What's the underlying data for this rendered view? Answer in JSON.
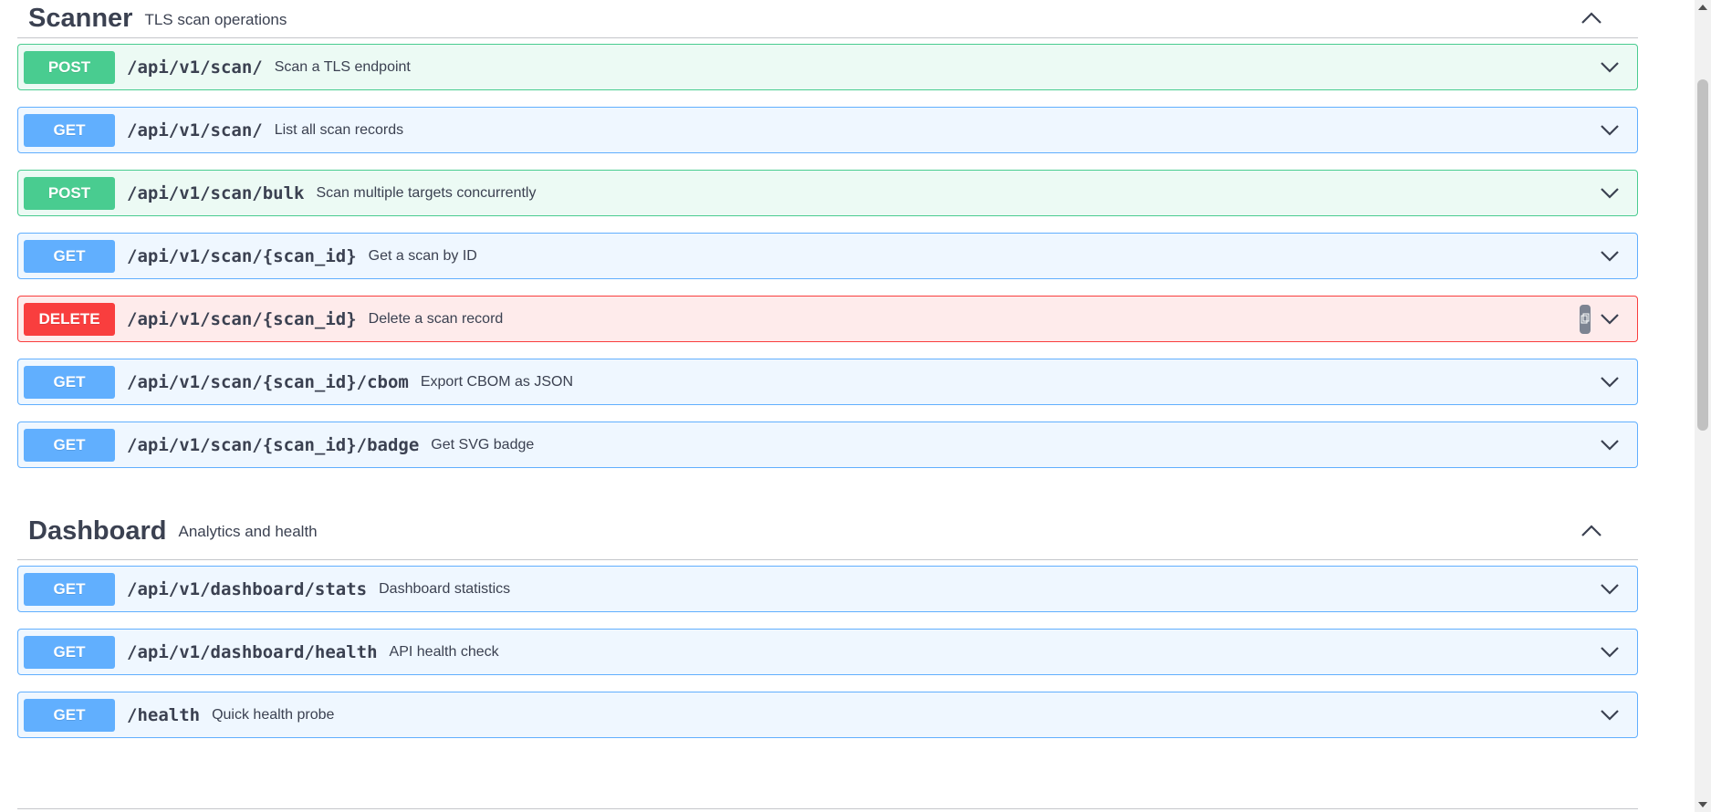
{
  "sections": [
    {
      "name": "Scanner",
      "description": "TLS scan operations",
      "operations": [
        {
          "method": "POST",
          "path": "/api/v1/scan/",
          "summary": "Scan a TLS endpoint"
        },
        {
          "method": "GET",
          "path": "/api/v1/scan/",
          "summary": "List all scan records"
        },
        {
          "method": "POST",
          "path": "/api/v1/scan/bulk",
          "summary": "Scan multiple targets concurrently"
        },
        {
          "method": "GET",
          "path": "/api/v1/scan/{scan_id}",
          "summary": "Get a scan by ID"
        },
        {
          "method": "DELETE",
          "path": "/api/v1/scan/{scan_id}",
          "summary": "Delete a scan record"
        },
        {
          "method": "GET",
          "path": "/api/v1/scan/{scan_id}/cbom",
          "summary": "Export CBOM as JSON"
        },
        {
          "method": "GET",
          "path": "/api/v1/scan/{scan_id}/badge",
          "summary": "Get SVG badge"
        }
      ]
    },
    {
      "name": "Dashboard",
      "description": "Analytics and health",
      "operations": [
        {
          "method": "GET",
          "path": "/api/v1/dashboard/stats",
          "summary": "Dashboard statistics"
        },
        {
          "method": "GET",
          "path": "/api/v1/dashboard/health",
          "summary": "API health check"
        },
        {
          "method": "GET",
          "path": "/health",
          "summary": "Quick health probe"
        }
      ]
    }
  ],
  "icons": {
    "section_toggle": "chevron-up-icon",
    "operation_toggle": "chevron-down-icon",
    "copy": "copy-icon"
  },
  "colors": {
    "post": "#49cc90",
    "get": "#61affe",
    "delete": "#f93e3e"
  }
}
